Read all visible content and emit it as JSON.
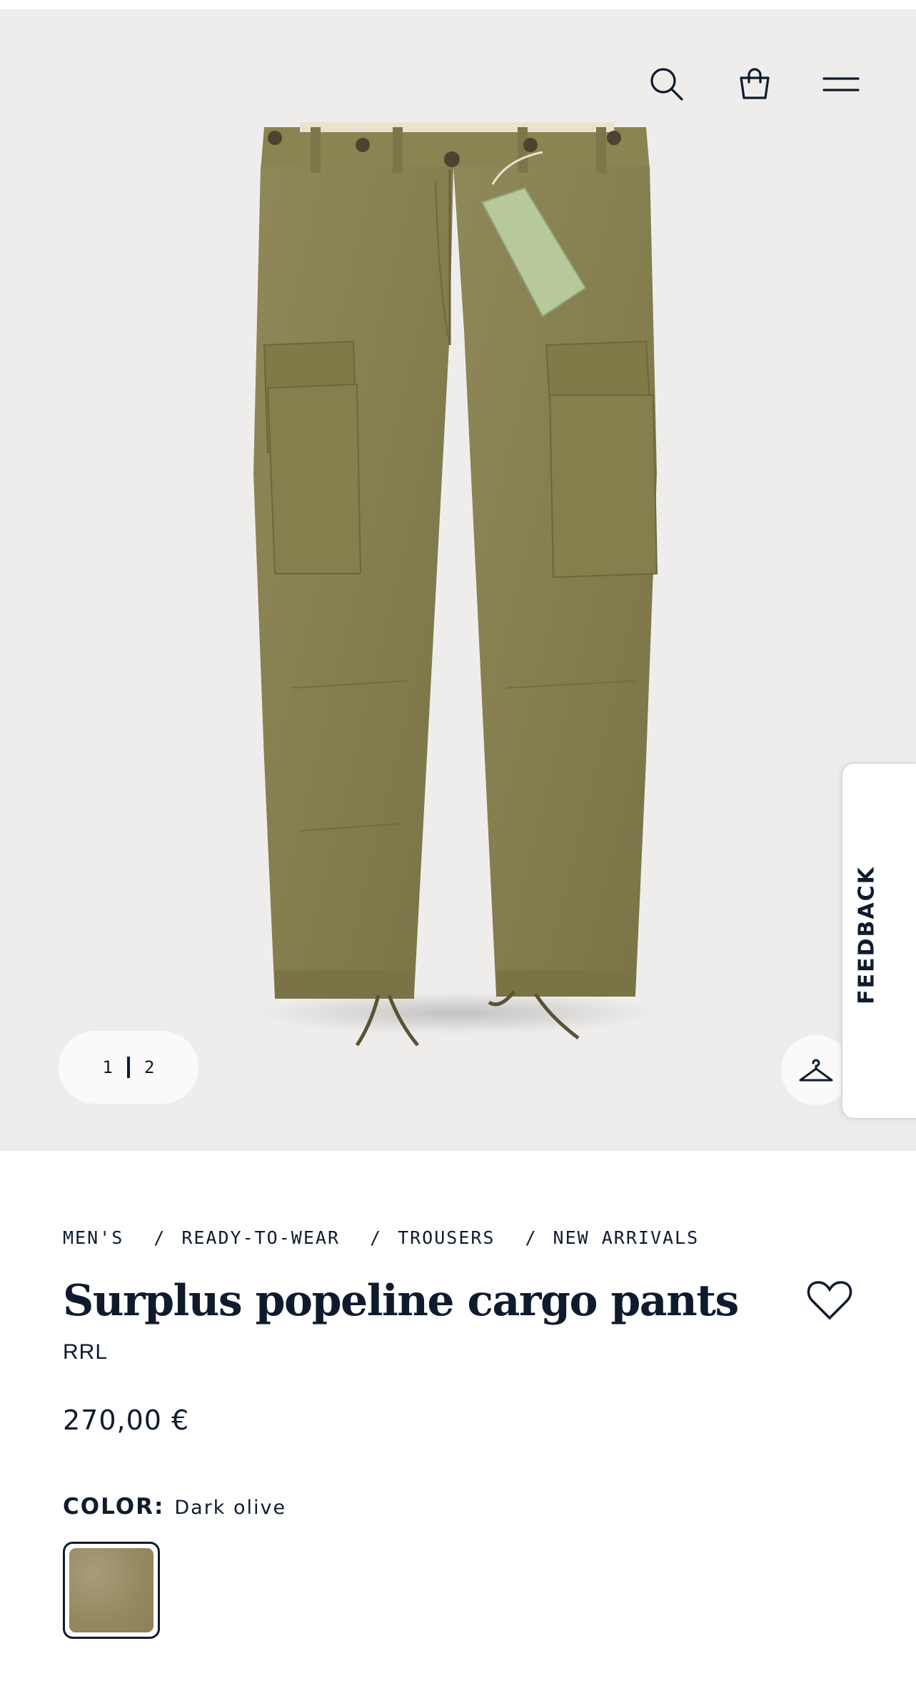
{
  "header": {
    "icons": [
      "search-icon",
      "shopping-bag-icon",
      "menu-icon"
    ]
  },
  "gallery": {
    "current_page": "1",
    "total_pages": "2",
    "image_subject": "olive cargo pants"
  },
  "feedback": {
    "label": "FEEDBACK"
  },
  "breadcrumb": [
    "MEN'S",
    "READY-TO-WEAR",
    "TROUSERS",
    "NEW ARRIVALS"
  ],
  "product": {
    "title": "Surplus popeline cargo pants",
    "brand": "RRL",
    "price": "270,00 €",
    "color_label": "COLOR:",
    "color_value": "Dark olive"
  },
  "colors": {
    "text": "#0f1b2d",
    "hero_background": "#efedec",
    "swatch": "#9a8f6c",
    "pants": "#8b8455"
  }
}
